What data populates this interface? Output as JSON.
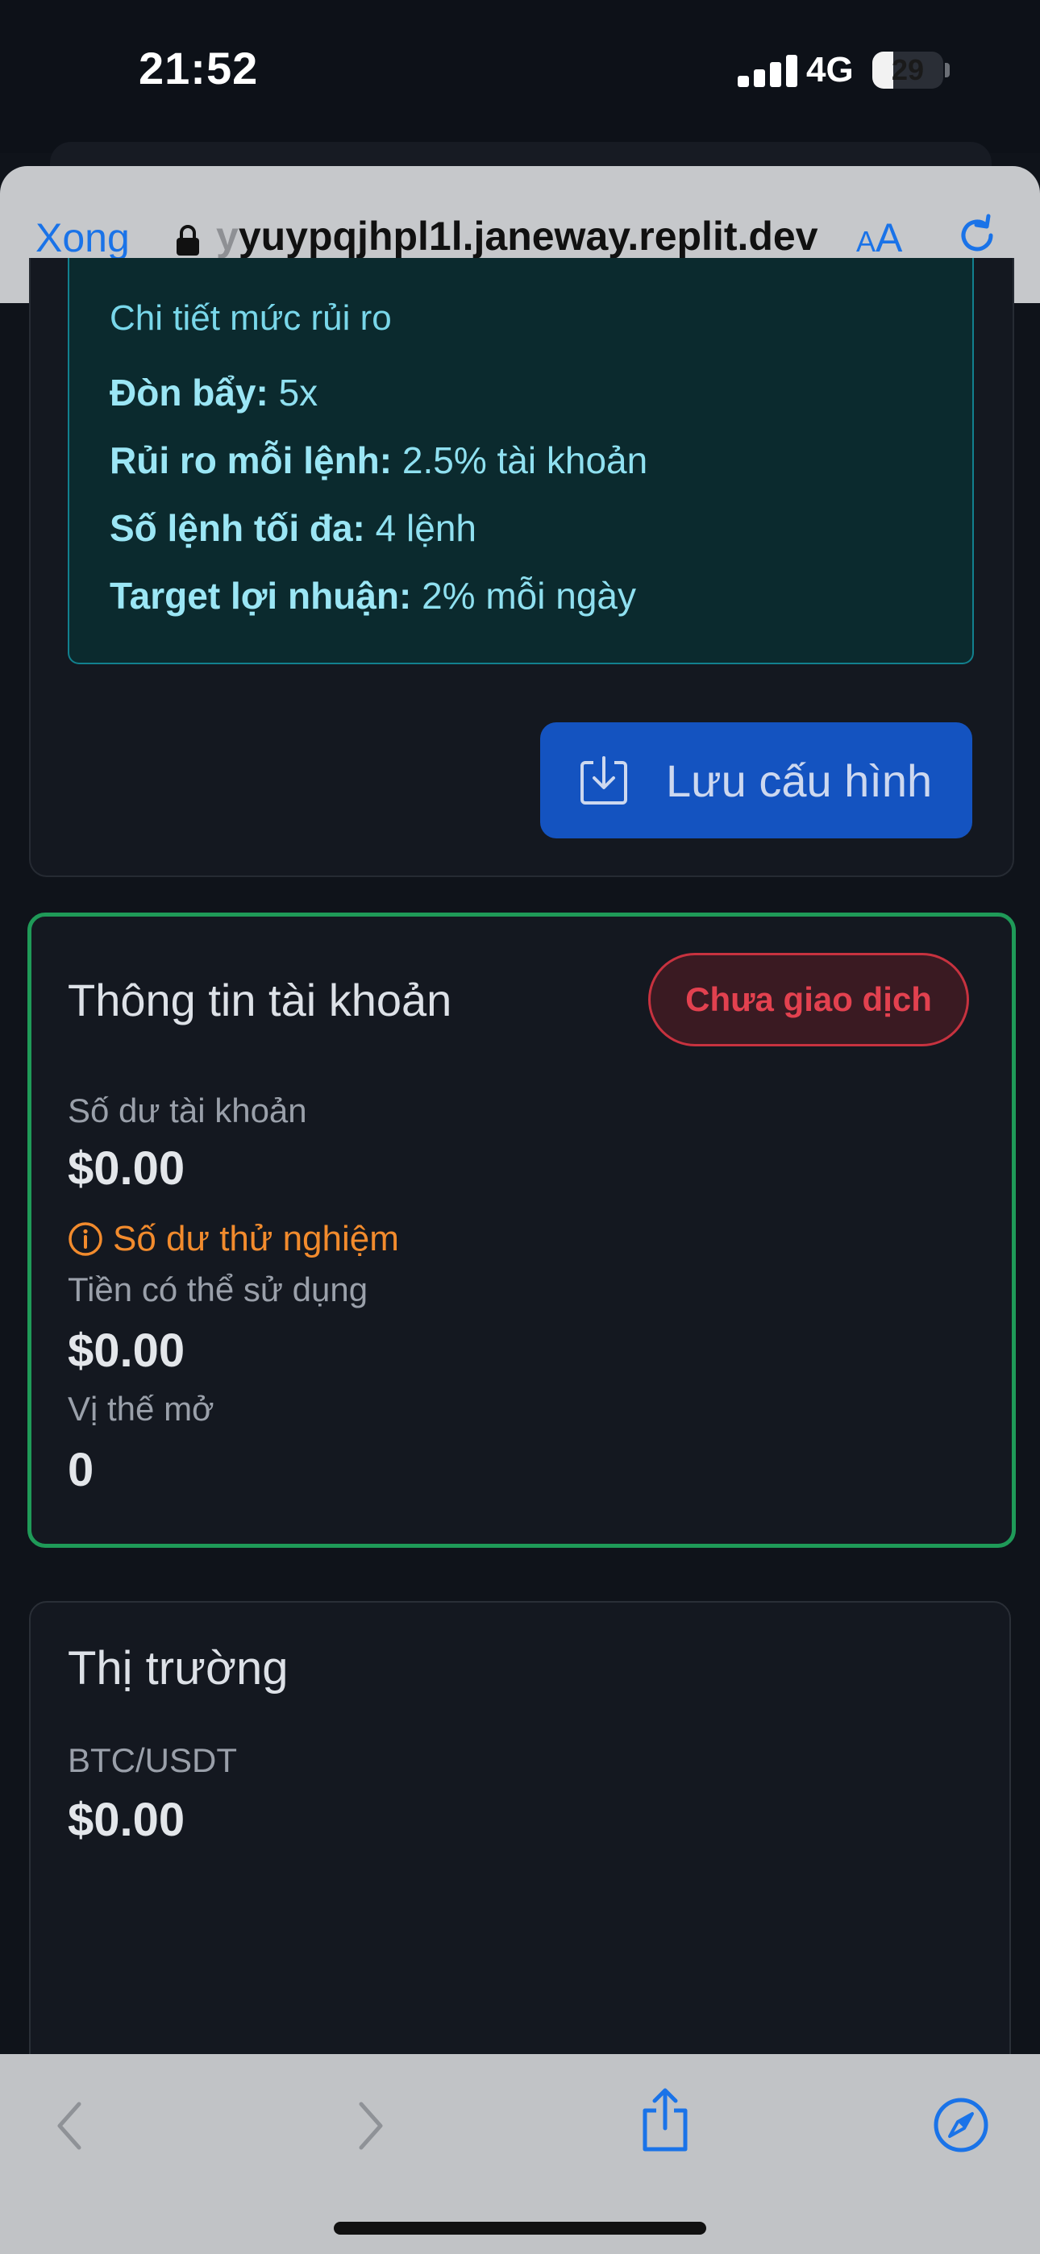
{
  "status_bar": {
    "time": "21:52",
    "network": "4G",
    "battery": "29",
    "battery_level": 0.29
  },
  "browser": {
    "done_label": "Xong",
    "url_faded": "y",
    "url": "yuypqjhpl1l.janeway.replit.dev",
    "text_size_small": "A",
    "text_size_large": "A"
  },
  "risk": {
    "title": "Chi tiết mức rủi ro",
    "rows": [
      {
        "label": "Đòn bẩy:",
        "value": "5x"
      },
      {
        "label": "Rủi ro mỗi lệnh:",
        "value": "2.5% tài khoản"
      },
      {
        "label": "Số lệnh tối đa:",
        "value": "4 lệnh"
      },
      {
        "label": "Target lợi nhuận:",
        "value": "2% mỗi ngày"
      }
    ],
    "save_label": "Lưu cấu hình"
  },
  "account": {
    "title": "Thông tin tài khoản",
    "status_badge": "Chưa giao dịch",
    "balance_label": "Số dư tài khoản",
    "balance_value": "$0.00",
    "demo_warning": "Số dư thử nghiệm",
    "available_label": "Tiền có thể sử dụng",
    "available_value": "$0.00",
    "positions_label": "Vị thế mở",
    "positions_value": "0"
  },
  "market": {
    "title": "Thị trường",
    "pair": "BTC/USDT",
    "price": "$0.00"
  },
  "colors": {
    "accent": "#1a73e8",
    "success_border": "#1f9a58",
    "danger": "#e2414f",
    "warning": "#f28b2d",
    "primary_button": "#1453c0"
  }
}
